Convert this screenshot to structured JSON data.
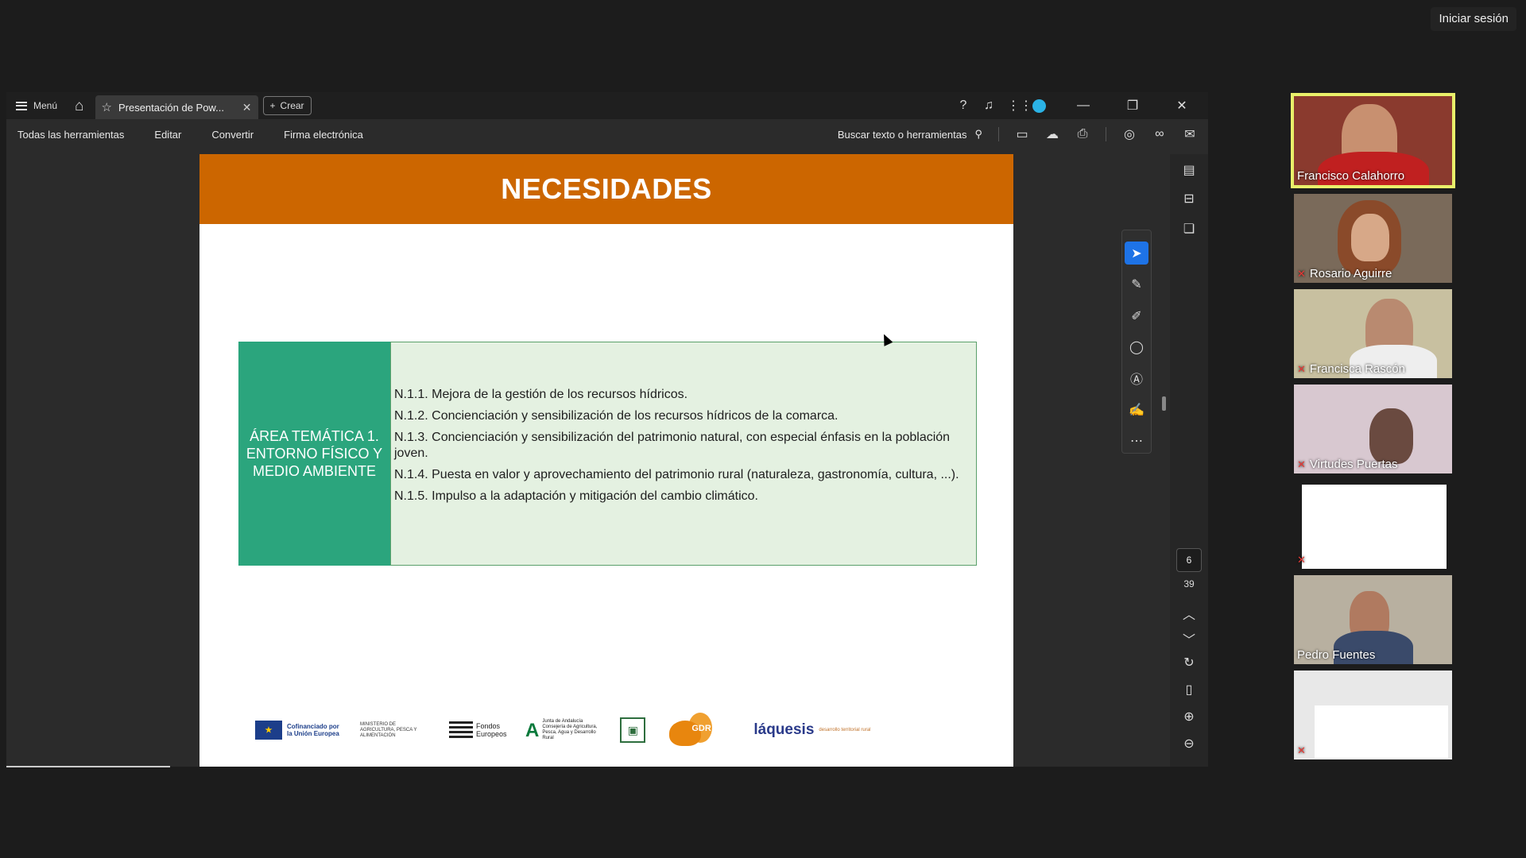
{
  "top_right": {
    "signin_label": "Iniciar sesión"
  },
  "titlebar": {
    "menu_label": "Menú",
    "tab_title": "Presentación de Pow...",
    "create_label": "Crear"
  },
  "toolbar": {
    "items": [
      "Todas las herramientas",
      "Editar",
      "Convertir",
      "Firma electrónica"
    ],
    "search_label": "Buscar texto o herramientas"
  },
  "slide": {
    "title": "NECESIDADES",
    "area_label": "ÁREA TEMÁTICA 1. ENTORNO FÍSICO Y MEDIO AMBIENTE",
    "needs": [
      "N.1.1. Mejora de la gestión de los recursos hídricos.",
      "N.1.2. Concienciación y sensibilización de los recursos hídricos de la comarca.",
      "N.1.3. Concienciación y sensibilización del patrimonio natural, con especial énfasis en la población joven.",
      "N.1.4. Puesta en valor y aprovechamiento del patrimonio rural (naturaleza, gastronomía, cultura, ...).",
      "N.1.5. Impulso a la adaptación y mitigación del cambio climático."
    ],
    "logos": {
      "eu_text": "Cofinanciado por la Unión Europea",
      "ministerio_text": "MINISTERIO DE AGRICULTURA, PESCA Y ALIMENTACIÓN",
      "fondos_text": "Fondos Europeos",
      "junta_text": "Junta de Andalucía Consejería de Agricultura, Pesca, Agua y Desarrollo Rural",
      "gdr_text": "GDR",
      "laquesis_text": "láquesis",
      "laquesis_sub": "desarrollo territorial rural"
    }
  },
  "page_nav": {
    "current": "6",
    "total": "39"
  },
  "participants": [
    {
      "name": "Francisco Calahorro",
      "muted": false,
      "speaking": true
    },
    {
      "name": "Rosario Aguirre",
      "muted": true
    },
    {
      "name": "Francisca Rascón",
      "muted": true
    },
    {
      "name": "Virtudes Puertas",
      "muted": true
    },
    {
      "name": "",
      "muted": true
    },
    {
      "name": "Pedro Fuentes",
      "muted": false
    },
    {
      "name": "",
      "muted": true
    }
  ],
  "colors": {
    "slide_header": "#cc6600",
    "area_box": "#2ba57d",
    "needs_box": "#e4f1e1",
    "active_tool": "#1e73e6",
    "speaker_outline": "#e9f06a"
  }
}
